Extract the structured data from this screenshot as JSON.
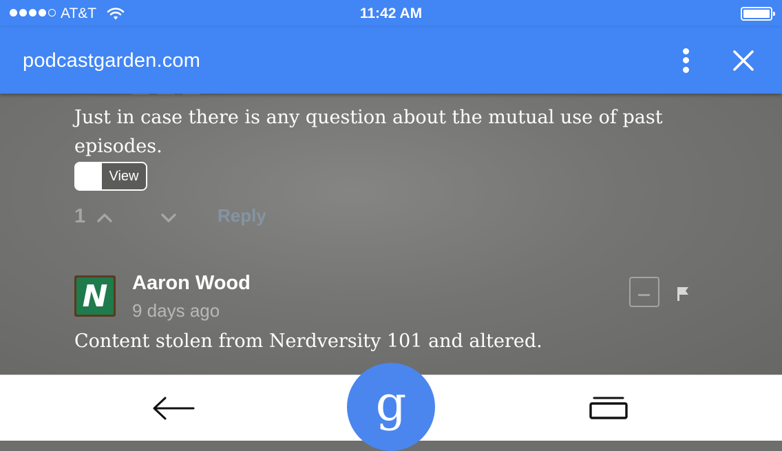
{
  "status_bar": {
    "carrier": "AT&T",
    "time": "11:42 AM",
    "signal_bars_filled": 4,
    "signal_bars_total": 5
  },
  "toolbar": {
    "url": "podcastgarden.com",
    "menu_icon": "more-vertical-icon",
    "close_icon": "close-icon"
  },
  "comments": [
    {
      "text": "Just in case there is any question about the mutual use of past episodes.",
      "toggle_label": "View",
      "votes": "1",
      "reply_label": "Reply"
    },
    {
      "avatar_letter": "N",
      "author": "Aaron Wood",
      "time": "9 days ago",
      "text": "Content stolen from Nerdversity 101 and altered."
    }
  ],
  "bottom_bar": {
    "back_icon": "back-arrow-icon",
    "google_label": "g",
    "tabs_icon": "tabs-icon"
  },
  "colors": {
    "brand_blue": "#4285f4",
    "google_button": "#4a86ee",
    "content_bg": "#6e6e6c",
    "reply_link": "#8494a3"
  }
}
